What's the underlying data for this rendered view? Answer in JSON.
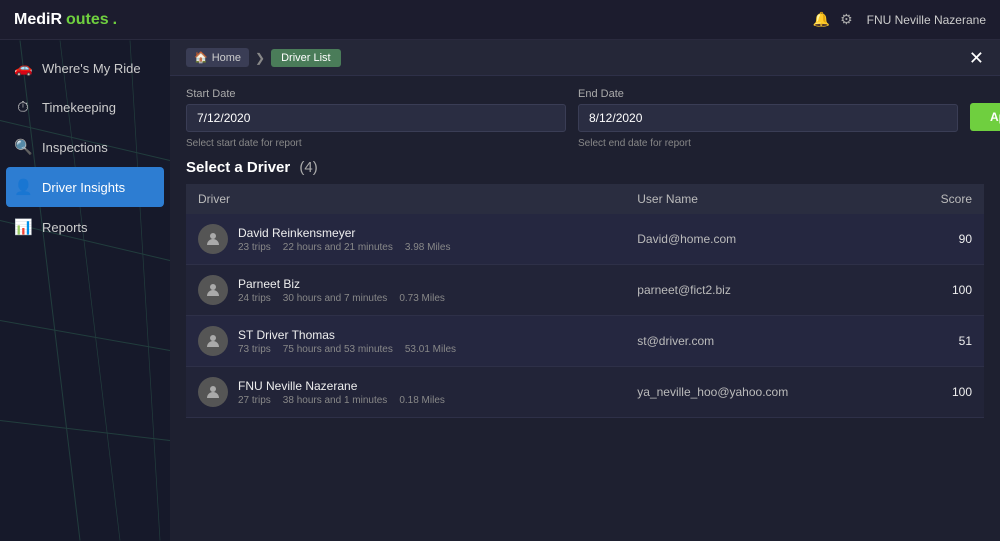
{
  "app": {
    "logo_medi": "MediR",
    "logo_routes": "outes",
    "logo_dot": ".",
    "user_name": "FNU Neville Nazerane"
  },
  "topbar": {
    "close_label": "✕",
    "bell_icon": "🔔",
    "gear_icon": "⚙"
  },
  "sidebar": {
    "items": [
      {
        "id": "wheres-my-ride",
        "label": "Where's My Ride",
        "icon": "🚗",
        "active": false
      },
      {
        "id": "timekeeping",
        "label": "Timekeeping",
        "icon": "⏱",
        "active": false
      },
      {
        "id": "inspections",
        "label": "Inspections",
        "icon": "🔍",
        "active": false
      },
      {
        "id": "driver-insights",
        "label": "Driver Insights",
        "icon": "👤",
        "active": true
      },
      {
        "id": "reports",
        "label": "Reports",
        "icon": "📊",
        "active": false
      }
    ]
  },
  "breadcrumb": {
    "home_label": "Home",
    "home_icon": "🏠",
    "current_label": "Driver List",
    "arrow": "❯"
  },
  "filters": {
    "start_date_label": "Start Date",
    "start_date_value": "7/12/2020",
    "start_date_hint": "Select start date for report",
    "end_date_label": "End Date",
    "end_date_value": "8/12/2020",
    "end_date_hint": "Select end date for report",
    "apply_label": "Apply"
  },
  "driver_list": {
    "title": "Select a Driver",
    "count": "(4)",
    "columns": {
      "driver": "Driver",
      "username": "User Name",
      "score": "Score"
    },
    "drivers": [
      {
        "name": "David Reinkensmeyer",
        "trips": "23 trips",
        "hours": "22 hours and 21 minutes",
        "miles": "3.98 Miles",
        "username": "David@home.com",
        "score": "90"
      },
      {
        "name": "Parneet Biz",
        "trips": "24 trips",
        "hours": "30 hours and 7 minutes",
        "miles": "0.73 Miles",
        "username": "parneet@fict2.biz",
        "score": "100"
      },
      {
        "name": "ST Driver Thomas",
        "trips": "73 trips",
        "hours": "75 hours and 53 minutes",
        "miles": "53.01 Miles",
        "username": "st@driver.com",
        "score": "51"
      },
      {
        "name": "FNU Neville Nazerane",
        "trips": "27 trips",
        "hours": "38 hours and 1 minutes",
        "miles": "0.18 Miles",
        "username": "ya_neville_hoo@yahoo.com",
        "score": "100"
      }
    ]
  }
}
